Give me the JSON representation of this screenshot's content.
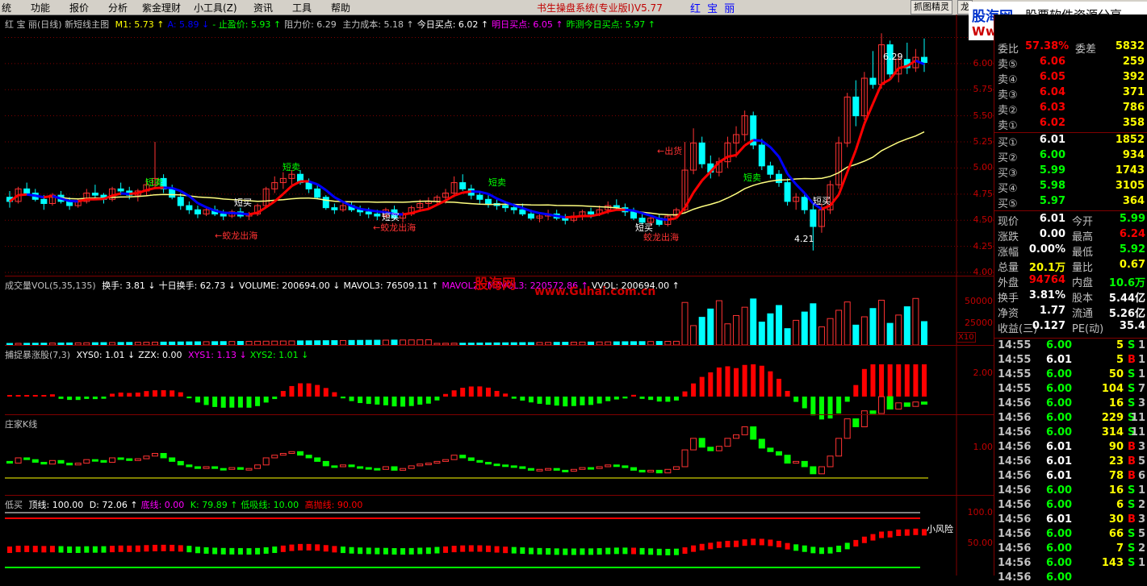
{
  "menu": [
    "统",
    "功能",
    "报价",
    "分析",
    "紫金理财",
    "小工具(Z)",
    "资讯",
    "工具",
    "帮助"
  ],
  "app_title": "书生操盘系统(专业版I)V5.77",
  "stock_name_top": "红 宝 丽",
  "toolbar": {
    "capture_label": "抓图精灵",
    "extra_label": "龙"
  },
  "logo": {
    "line1": "股海网",
    "line2": "股票软件资源分享",
    "line3": "Www.Guhai.com.cn"
  },
  "main_chart": {
    "indicator": "红 宝 丽(日线) 新短线主图",
    "values": [
      {
        "label": "M1: 5.73",
        "arrow": "↑",
        "color": "#ffff00"
      },
      {
        "label": "A: 5.89",
        "arrow": "↓",
        "color": "#0000ff"
      },
      {
        "label": "- 止盈价: 5.93",
        "arrow": "↑",
        "color": "#00ff00"
      },
      {
        "label": "阻力价: 6.29",
        "arrow": "",
        "color": "#c0c0c0"
      },
      {
        "label": "主力成本: 5.18",
        "arrow": "↑",
        "color": "#c0c0c0"
      },
      {
        "label": "今日买点: 6.02",
        "arrow": "↑",
        "color": "#ffffff"
      },
      {
        "label": "明日买点: 6.05",
        "arrow": "↑",
        "color": "#ff00ff"
      },
      {
        "label": "昨测今日买点: 5.97",
        "arrow": "↑",
        "color": "#00ff00"
      }
    ],
    "y_ticks": [
      "6.25",
      "6.00",
      "5.75",
      "5.50",
      "5.25",
      "5.00",
      "4.75",
      "4.50",
      "4.25",
      "4.00"
    ],
    "annotations": {
      "duanmai": "短卖",
      "duanmai2": "短卖",
      "duanmai3": "短卖",
      "duanmai4": "短卖",
      "duanbuy1": "短买",
      "duanbuy2": "短买",
      "duanbuy3": "短买",
      "duanbuy4": "短买",
      "jiaolong1": "←蛟龙出海",
      "jiaolong2": "←蛟龙出海",
      "jiaolong3": "蛟龙出海",
      "chuhuo": "←出货",
      "high": "6.29",
      "low": "4.21"
    }
  },
  "volume": {
    "indicator": "成交量VOL(5,35,135)",
    "values": [
      {
        "label": "换手: 3.81",
        "arrow": "↓",
        "color": "#ffffff"
      },
      {
        "label": "十日换手: 62.73",
        "arrow": "↓",
        "color": "#ffffff"
      },
      {
        "label": "VOLUME: 200694.00",
        "arrow": "↓",
        "color": "#ffffff"
      },
      {
        "label": "MAVOL3: 76509.11",
        "arrow": "↑",
        "color": "#ffffff"
      },
      {
        "label": "MAVOL2:",
        "arrow": "",
        "color": "#ff00ff"
      },
      {
        "label": "MAVOL3: 220572.86",
        "arrow": "↑",
        "color": "#ff00ff"
      },
      {
        "label": "VVOL: 200694.00",
        "arrow": "↑",
        "color": "#ffffff"
      }
    ],
    "y_ticks": [
      "50000",
      "25000"
    ],
    "unit": "X10",
    "watermark1": "股海网",
    "watermark2": "www.Guhai.com.cn"
  },
  "capture": {
    "indicator": "捕捉暴涨股(7,3)",
    "values": [
      {
        "label": "XYS0: 1.01",
        "arrow": "↓",
        "color": "#ffffff"
      },
      {
        "label": "ZZX: 0.00",
        "arrow": "",
        "color": "#ffffff"
      },
      {
        "label": "XYS1: 1.13",
        "arrow": "↓",
        "color": "#ff00ff"
      },
      {
        "label": "XYS2: 1.01",
        "arrow": "↓",
        "color": "#00ff00"
      }
    ],
    "y_ticks": [
      "2.00"
    ]
  },
  "banker": {
    "indicator": "庄家K线",
    "y_ticks": [
      "1.00"
    ]
  },
  "bottom": {
    "indicator": "低买",
    "values": [
      {
        "label": "顶线: 100.00",
        "arrow": "",
        "color": "#ffffff"
      },
      {
        "label": "D: 72.06",
        "arrow": "↑",
        "color": "#ffffff"
      },
      {
        "label": "底线: 0.00",
        "arrow": "",
        "color": "#ff00ff"
      },
      {
        "label": "K: 79.89",
        "arrow": "↑",
        "color": "#00ff00"
      },
      {
        "label": "低吸线: 10.00",
        "arrow": "",
        "color": "#00ff00"
      },
      {
        "label": "高抛线: 90.00",
        "arrow": "",
        "color": "#ff0000"
      }
    ],
    "y_ticks": [
      "100.0",
      "50.00"
    ],
    "risk_label": "小风险"
  },
  "quote": {
    "top_row": {
      "label": "委比",
      "value": "57.38%",
      "label2": "委差",
      "value2": "5832"
    },
    "sells": [
      {
        "label": "卖⑤",
        "price": "6.06",
        "vol": "259"
      },
      {
        "label": "卖④",
        "price": "6.05",
        "vol": "392"
      },
      {
        "label": "卖③",
        "price": "6.04",
        "vol": "371"
      },
      {
        "label": "卖②",
        "price": "6.03",
        "vol": "786"
      },
      {
        "label": "卖①",
        "price": "6.02",
        "vol": "358"
      }
    ],
    "buys": [
      {
        "label": "买①",
        "price": "6.01",
        "vol": "1852"
      },
      {
        "label": "买②",
        "price": "6.00",
        "vol": "934"
      },
      {
        "label": "买③",
        "price": "5.99",
        "vol": "1743"
      },
      {
        "label": "买④",
        "price": "5.98",
        "vol": "3105"
      },
      {
        "label": "买⑤",
        "price": "5.97",
        "vol": "364"
      }
    ],
    "stats": [
      {
        "l1": "现价",
        "v1": "6.01",
        "c1": "#ffffff",
        "l2": "今开",
        "v2": "5.99",
        "c2": "#00ff00"
      },
      {
        "l1": "涨跌",
        "v1": "0.00",
        "c1": "#ffffff",
        "l2": "最高",
        "v2": "6.24",
        "c2": "#ff0000"
      },
      {
        "l1": "涨幅",
        "v1": "0.00%",
        "c1": "#ffffff",
        "l2": "最低",
        "v2": "5.92",
        "c2": "#00ff00"
      },
      {
        "l1": "总量",
        "v1": "20.1万",
        "c1": "#ffff00",
        "l2": "量比",
        "v2": "0.67",
        "c2": "#ffff00"
      },
      {
        "l1": "外盘",
        "v1": "94764",
        "c1": "#ff0000",
        "l2": "内盘",
        "v2": "10.6万",
        "c2": "#00ff00"
      },
      {
        "l1": "换手",
        "v1": "3.81%",
        "c1": "#ffffff",
        "l2": "股本",
        "v2": "5.44亿",
        "c2": "#ffffff"
      },
      {
        "l1": "净资",
        "v1": "1.77",
        "c1": "#ffffff",
        "l2": "流通",
        "v2": "5.26亿",
        "c2": "#ffffff"
      },
      {
        "l1": "收益(三)",
        "v1": "0.127",
        "c1": "#ffffff",
        "l2": "PE(动)",
        "v2": "35.4",
        "c2": "#ffffff"
      }
    ],
    "ticks": [
      {
        "time": "14:55",
        "price": "6.00",
        "vol": "5",
        "side": "S",
        "n": "1"
      },
      {
        "time": "14:55",
        "price": "6.01",
        "vol": "5",
        "side": "B",
        "n": "1"
      },
      {
        "time": "14:55",
        "price": "6.00",
        "vol": "50",
        "side": "S",
        "n": "1"
      },
      {
        "time": "14:55",
        "price": "6.00",
        "vol": "104",
        "side": "S",
        "n": "7"
      },
      {
        "time": "14:56",
        "price": "6.00",
        "vol": "16",
        "side": "S",
        "n": "3"
      },
      {
        "time": "14:56",
        "price": "6.00",
        "vol": "229",
        "side": "S",
        "n": "11"
      },
      {
        "time": "14:56",
        "price": "6.00",
        "vol": "314",
        "side": "S",
        "n": "11"
      },
      {
        "time": "14:56",
        "price": "6.01",
        "vol": "90",
        "side": "B",
        "n": "3"
      },
      {
        "time": "14:56",
        "price": "6.01",
        "vol": "23",
        "side": "B",
        "n": "5"
      },
      {
        "time": "14:56",
        "price": "6.01",
        "vol": "78",
        "side": "B",
        "n": "6"
      },
      {
        "time": "14:56",
        "price": "6.00",
        "vol": "16",
        "side": "S",
        "n": "1"
      },
      {
        "time": "14:56",
        "price": "6.00",
        "vol": "6",
        "side": "S",
        "n": "2"
      },
      {
        "time": "14:56",
        "price": "6.01",
        "vol": "30",
        "side": "B",
        "n": "3"
      },
      {
        "time": "14:56",
        "price": "6.00",
        "vol": "66",
        "side": "S",
        "n": "5"
      },
      {
        "time": "14:56",
        "price": "6.00",
        "vol": "7",
        "side": "S",
        "n": "2"
      },
      {
        "time": "14:56",
        "price": "6.00",
        "vol": "143",
        "side": "S",
        "n": "1"
      },
      {
        "time": "14:56",
        "price": "6.00",
        "vol": "",
        "side": "",
        "n": ""
      }
    ]
  },
  "colors": {
    "up": "#ff3232",
    "down": "#00ffff",
    "ma_red": "#ff0000",
    "ma_blue": "#0000ff",
    "ma_yellow": "#ffff80",
    "grid": "#800000"
  },
  "chart_data": {
    "type": "candlestick",
    "ohlc": [
      [
        4.72,
        4.78,
        4.62,
        4.68
      ],
      [
        4.68,
        4.82,
        4.66,
        4.8
      ],
      [
        4.8,
        4.86,
        4.74,
        4.76
      ],
      [
        4.76,
        4.8,
        4.68,
        4.7
      ],
      [
        4.7,
        4.74,
        4.6,
        4.66
      ],
      [
        4.66,
        4.76,
        4.64,
        4.74
      ],
      [
        4.74,
        4.78,
        4.66,
        4.68
      ],
      [
        4.68,
        4.72,
        4.6,
        4.64
      ],
      [
        4.64,
        4.7,
        4.62,
        4.68
      ],
      [
        4.68,
        4.8,
        4.66,
        4.76
      ],
      [
        4.76,
        4.84,
        4.7,
        4.74
      ],
      [
        4.74,
        4.76,
        4.66,
        4.7
      ],
      [
        4.7,
        4.82,
        4.68,
        4.8
      ],
      [
        4.8,
        4.86,
        4.74,
        4.78
      ],
      [
        4.78,
        4.82,
        4.7,
        4.74
      ],
      [
        4.74,
        4.8,
        4.68,
        4.78
      ],
      [
        4.78,
        4.9,
        4.74,
        4.84
      ],
      [
        4.84,
        5.25,
        4.8,
        4.9
      ],
      [
        4.9,
        4.94,
        4.76,
        4.8
      ],
      [
        4.8,
        4.84,
        4.7,
        4.72
      ],
      [
        4.72,
        4.76,
        4.6,
        4.64
      ],
      [
        4.64,
        4.68,
        4.56,
        4.6
      ],
      [
        4.6,
        4.64,
        4.52,
        4.56
      ],
      [
        4.56,
        4.62,
        4.54,
        4.6
      ],
      [
        4.6,
        4.64,
        4.54,
        4.56
      ],
      [
        4.56,
        4.6,
        4.5,
        4.54
      ],
      [
        4.54,
        4.6,
        4.52,
        4.58
      ],
      [
        4.58,
        4.62,
        4.52,
        4.54
      ],
      [
        4.54,
        4.58,
        4.5,
        4.56
      ],
      [
        4.56,
        4.66,
        4.54,
        4.64
      ],
      [
        4.64,
        4.82,
        4.62,
        4.8
      ],
      [
        4.8,
        4.92,
        4.76,
        4.86
      ],
      [
        4.86,
        4.96,
        4.8,
        4.9
      ],
      [
        4.9,
        4.98,
        4.84,
        4.94
      ],
      [
        4.94,
        4.98,
        4.84,
        4.86
      ],
      [
        4.86,
        4.9,
        4.76,
        4.8
      ],
      [
        4.8,
        4.84,
        4.7,
        4.72
      ],
      [
        4.72,
        4.74,
        4.6,
        4.62
      ],
      [
        4.62,
        4.66,
        4.56,
        4.6
      ],
      [
        4.6,
        4.68,
        4.58,
        4.64
      ],
      [
        4.64,
        4.68,
        4.58,
        4.6
      ],
      [
        4.6,
        4.64,
        4.54,
        4.58
      ],
      [
        4.58,
        4.62,
        4.52,
        4.56
      ],
      [
        4.56,
        4.6,
        4.5,
        4.54
      ],
      [
        4.54,
        4.62,
        4.52,
        4.6
      ],
      [
        4.6,
        4.64,
        4.5,
        4.52
      ],
      [
        4.52,
        4.58,
        4.48,
        4.56
      ],
      [
        4.56,
        4.64,
        4.54,
        4.62
      ],
      [
        4.62,
        4.7,
        4.58,
        4.66
      ],
      [
        4.66,
        4.72,
        4.6,
        4.68
      ],
      [
        4.68,
        4.74,
        4.64,
        4.72
      ],
      [
        4.72,
        4.8,
        4.66,
        4.76
      ],
      [
        4.76,
        4.92,
        4.72,
        4.86
      ],
      [
        4.86,
        4.94,
        4.78,
        4.8
      ],
      [
        4.8,
        4.84,
        4.7,
        4.74
      ],
      [
        4.74,
        4.78,
        4.66,
        4.7
      ],
      [
        4.7,
        4.74,
        4.62,
        4.66
      ],
      [
        4.66,
        4.7,
        4.6,
        4.64
      ],
      [
        4.64,
        4.68,
        4.58,
        4.62
      ],
      [
        4.62,
        4.66,
        4.56,
        4.6
      ],
      [
        4.6,
        4.66,
        4.54,
        4.56
      ],
      [
        4.56,
        4.6,
        4.5,
        4.52
      ],
      [
        4.52,
        4.56,
        4.48,
        4.54
      ],
      [
        4.54,
        4.6,
        4.5,
        4.56
      ],
      [
        4.56,
        4.6,
        4.5,
        4.52
      ],
      [
        4.52,
        4.56,
        4.46,
        4.5
      ],
      [
        4.5,
        4.58,
        4.48,
        4.54
      ],
      [
        4.54,
        4.6,
        4.5,
        4.58
      ],
      [
        4.58,
        4.62,
        4.52,
        4.56
      ],
      [
        4.56,
        4.64,
        4.54,
        4.6
      ],
      [
        4.6,
        4.68,
        4.56,
        4.64
      ],
      [
        4.64,
        4.7,
        4.6,
        4.62
      ],
      [
        4.62,
        4.66,
        4.54,
        4.58
      ],
      [
        4.58,
        4.62,
        4.5,
        4.52
      ],
      [
        4.52,
        4.56,
        4.46,
        4.48
      ],
      [
        4.48,
        4.54,
        4.44,
        4.52
      ],
      [
        4.52,
        4.56,
        4.44,
        4.46
      ],
      [
        4.46,
        4.56,
        4.44,
        4.54
      ],
      [
        4.54,
        4.62,
        4.52,
        4.6
      ],
      [
        4.6,
        5.25,
        4.58,
        4.98
      ],
      [
        4.98,
        5.38,
        4.94,
        5.24
      ],
      [
        5.24,
        5.3,
        5.0,
        5.04
      ],
      [
        5.04,
        5.12,
        4.9,
        4.96
      ],
      [
        4.96,
        5.1,
        4.92,
        5.06
      ],
      [
        5.06,
        5.3,
        5.0,
        5.24
      ],
      [
        5.24,
        5.4,
        5.1,
        5.32
      ],
      [
        5.32,
        5.55,
        5.26,
        5.5
      ],
      [
        5.5,
        5.54,
        5.18,
        5.22
      ],
      [
        5.22,
        5.28,
        4.98,
        5.02
      ],
      [
        5.02,
        5.06,
        4.9,
        4.94
      ],
      [
        4.94,
        4.98,
        4.82,
        4.86
      ],
      [
        4.86,
        4.9,
        4.64,
        4.68
      ],
      [
        4.68,
        4.76,
        4.6,
        4.72
      ],
      [
        4.72,
        4.76,
        4.56,
        4.6
      ],
      [
        4.6,
        4.66,
        4.21,
        4.44
      ],
      [
        4.44,
        4.66,
        4.38,
        4.6
      ],
      [
        4.6,
        4.88,
        4.56,
        4.84
      ],
      [
        4.84,
        5.3,
        4.8,
        5.24
      ],
      [
        5.24,
        5.72,
        5.2,
        5.68
      ],
      [
        5.68,
        5.84,
        5.4,
        5.5
      ],
      [
        5.5,
        5.92,
        5.46,
        5.86
      ],
      [
        5.86,
        6.12,
        5.76,
        5.8
      ],
      [
        5.8,
        6.29,
        5.76,
        6.18
      ],
      [
        6.18,
        6.22,
        5.84,
        5.9
      ],
      [
        5.9,
        6.1,
        5.82,
        6.04
      ],
      [
        6.04,
        6.2,
        5.9,
        5.96
      ],
      [
        5.96,
        6.14,
        5.92,
        6.06
      ],
      [
        6.06,
        6.24,
        5.92,
        6.01
      ]
    ],
    "y_range": [
      4.0,
      6.3
    ],
    "ma_lines": [
      "M1",
      "A",
      "主力成本"
    ],
    "volume_range": [
      0,
      60000
    ],
    "xlabel": "",
    "ylabel": ""
  }
}
